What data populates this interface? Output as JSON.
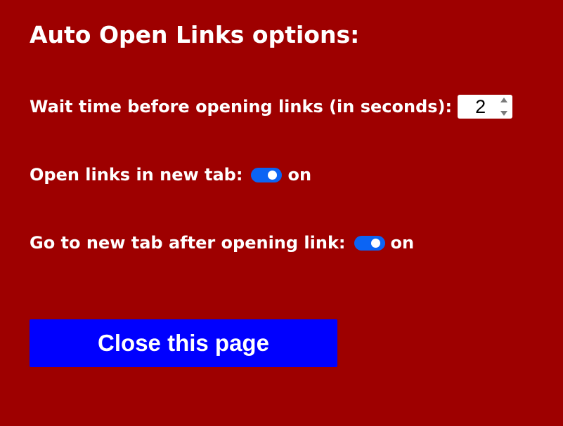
{
  "page": {
    "title": "Auto Open Links options:"
  },
  "options": {
    "wait_time": {
      "label": "Wait time before opening links (in seconds):",
      "value": "2"
    },
    "open_in_new_tab": {
      "label": "Open links in new tab:",
      "state_text": "on",
      "enabled": true
    },
    "go_to_new_tab": {
      "label": "Go to new tab after opening link:",
      "state_text": "on",
      "enabled": true
    }
  },
  "actions": {
    "close_label": "Close this page"
  },
  "colors": {
    "background": "#9e0000",
    "toggle_on": "#0b64f4",
    "button": "#0000ff",
    "text": "#ffffff"
  },
  "icons": {
    "spin_up": "triangle-up-icon",
    "spin_down": "triangle-down-icon"
  }
}
